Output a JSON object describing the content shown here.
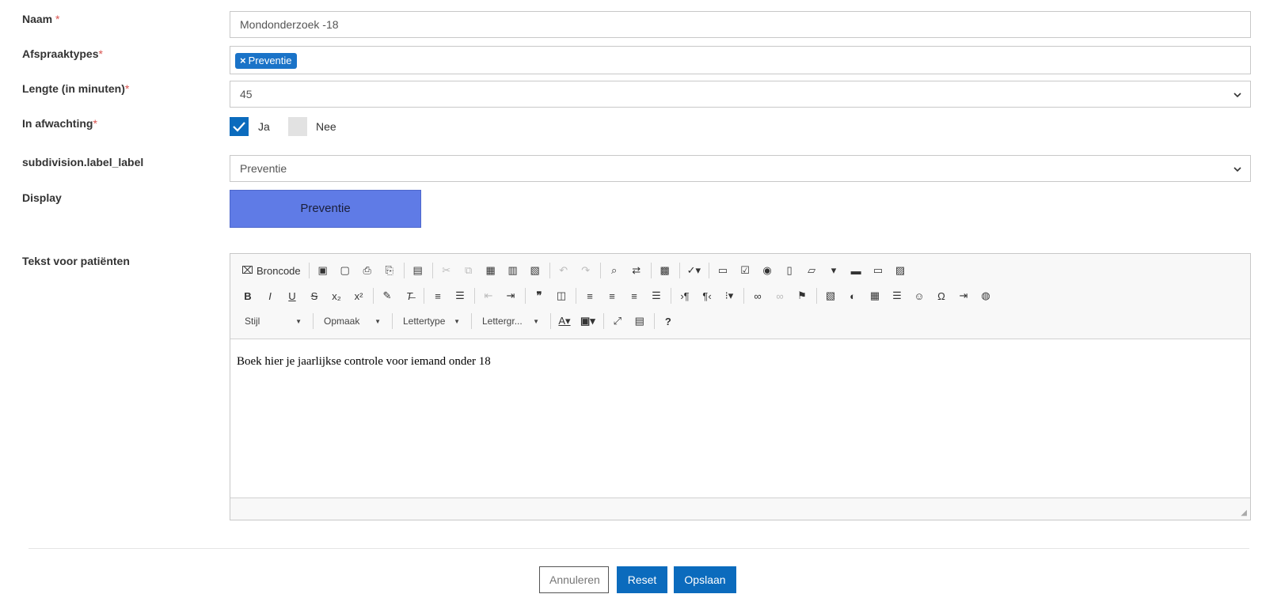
{
  "form": {
    "naam": {
      "label": "Naam",
      "required": "*",
      "value": "Mondonderzoek -18"
    },
    "afspraaktypes": {
      "label": "Afspraaktypes",
      "required": "*",
      "tag_remove": "×",
      "tag": "Preventie"
    },
    "lengte": {
      "label": "Lengte (in minuten)",
      "required": "*",
      "value": "45",
      "chevron_icon": "chevron-down-icon"
    },
    "in_afwachting": {
      "label": "In afwachting",
      "required": "*",
      "ja": "Ja",
      "ja_checked": true,
      "nee": "Nee",
      "nee_checked": false
    },
    "subdivision": {
      "label": "subdivision.label_label",
      "value": "Preventie",
      "chevron_icon": "chevron-down-icon"
    },
    "display": {
      "label": "Display",
      "value": "Preventie",
      "color": "#5f7be6"
    },
    "tekst": {
      "label": "Tekst voor patiënten"
    }
  },
  "editor": {
    "source_label": "Broncode",
    "combos": {
      "stijl": "Stijl",
      "opmaak": "Opmaak",
      "lettertype": "Lettertype",
      "lettergrootte": "Lettergr..."
    },
    "content": "Boek hier je jaarlijkse controle voor iemand onder 18"
  },
  "actions": {
    "cancel": "Annuleren",
    "reset": "Reset",
    "save": "Opslaan"
  },
  "colors": {
    "primary": "#0b6bbd",
    "required": "#d9534f",
    "display_bg": "#5f7be6"
  }
}
